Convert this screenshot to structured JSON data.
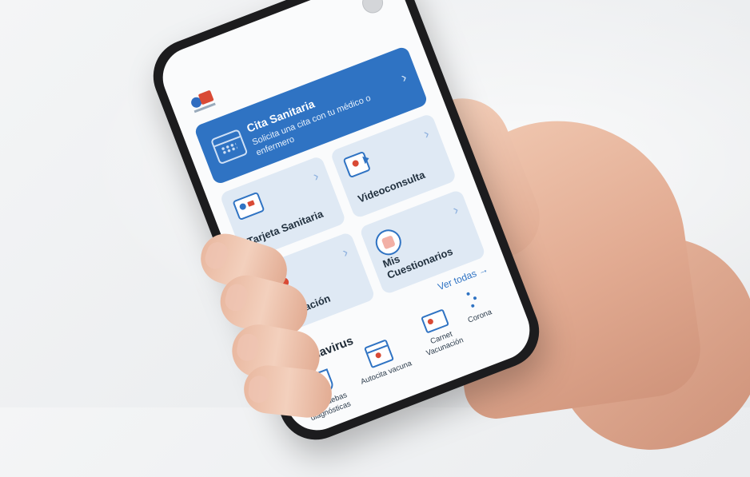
{
  "app": {
    "camera_icon": "camera-icon",
    "logo_icon": "health-logo-icon",
    "cita": {
      "title": "Cita Sanitaria",
      "subtitle": "Solicita una cita con tu médico o enfermero",
      "icon": "calendar-icon"
    },
    "tiles": [
      {
        "label": "Tarjeta Sanitaria",
        "icon": "id-card-icon"
      },
      {
        "label": "Videoconsulta",
        "icon": "video-camera-icon"
      },
      {
        "label": "Medicación",
        "icon": "medication-icon"
      },
      {
        "label": "Mis Cuestionarios",
        "icon": "questionnaire-icon"
      }
    ],
    "see_all": "Ver todas",
    "section_title": "Coronavirus",
    "corona_items": [
      {
        "label": "Mis pruebas diagnósticas",
        "icon": "flask-icon"
      },
      {
        "label": "Autocita vacuna",
        "icon": "calendar-vaccine-icon"
      },
      {
        "label": "Carnet Vacunación",
        "icon": "vaccination-card-icon"
      },
      {
        "label": "Corona",
        "icon": "virus-icon"
      }
    ],
    "colors": {
      "primary": "#2f73c3",
      "accent": "#d94a35",
      "tile": "#dfe9f4"
    }
  }
}
